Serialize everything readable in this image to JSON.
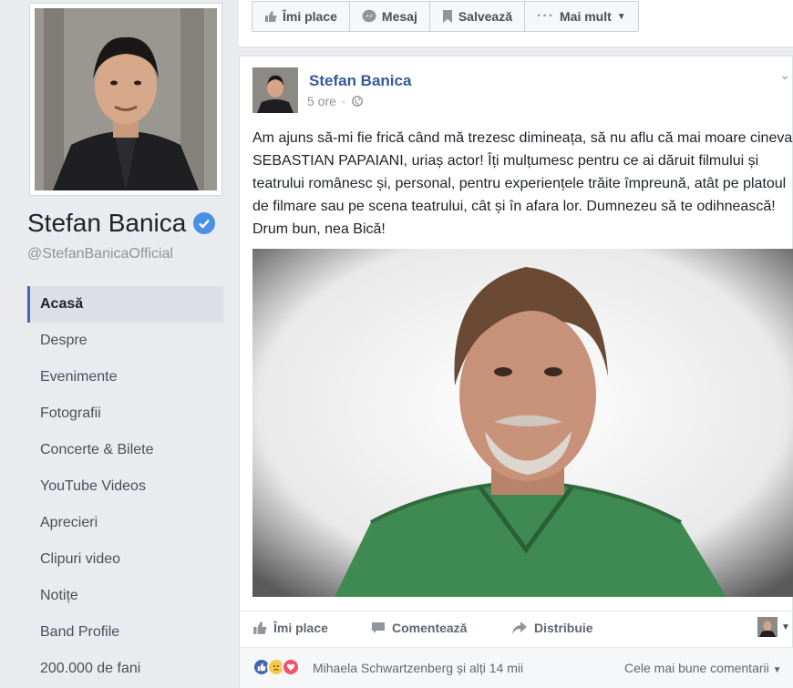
{
  "sidebar": {
    "page_name": "Stefan Banica",
    "handle": "@StefanBanicaOfficial",
    "nav": [
      {
        "label": "Acasă",
        "active": true
      },
      {
        "label": "Despre"
      },
      {
        "label": "Evenimente"
      },
      {
        "label": "Fotografii"
      },
      {
        "label": "Concerte & Bilete"
      },
      {
        "label": "YouTube Videos"
      },
      {
        "label": "Aprecieri"
      },
      {
        "label": "Clipuri video"
      },
      {
        "label": "Notițe"
      },
      {
        "label": "Band Profile"
      },
      {
        "label": "200.000 de fani"
      }
    ]
  },
  "actions": {
    "like": "Îmi place",
    "message": "Mesaj",
    "save": "Salvează",
    "more": "Mai mult"
  },
  "post": {
    "author": "Stefan Banica",
    "time": "5 ore",
    "text": "Am ajuns să-mi fie frică când mă trezesc dimineața, să nu aflu că mai moare cineva. SEBASTIAN PAPAIANI, uriaș actor! Îți mulțumesc pentru ce ai dăruit filmului și teatrului românesc și, personal, pentru experiențele trăite împreună, atât pe platoul de filmare sau pe scena teatrului, cât și în afara lor. Dumnezeu să te odihnească! Drum bun, nea Bică!",
    "like": "Îmi place",
    "comment": "Comentează",
    "share": "Distribuie",
    "reactions_text": "Mihaela Schwartzenberg și alți 14 mii",
    "sort_label": "Cele mai bune comentarii"
  },
  "colors": {
    "link": "#365899",
    "accent": "#4267b2",
    "verified": "#4a90e2"
  }
}
